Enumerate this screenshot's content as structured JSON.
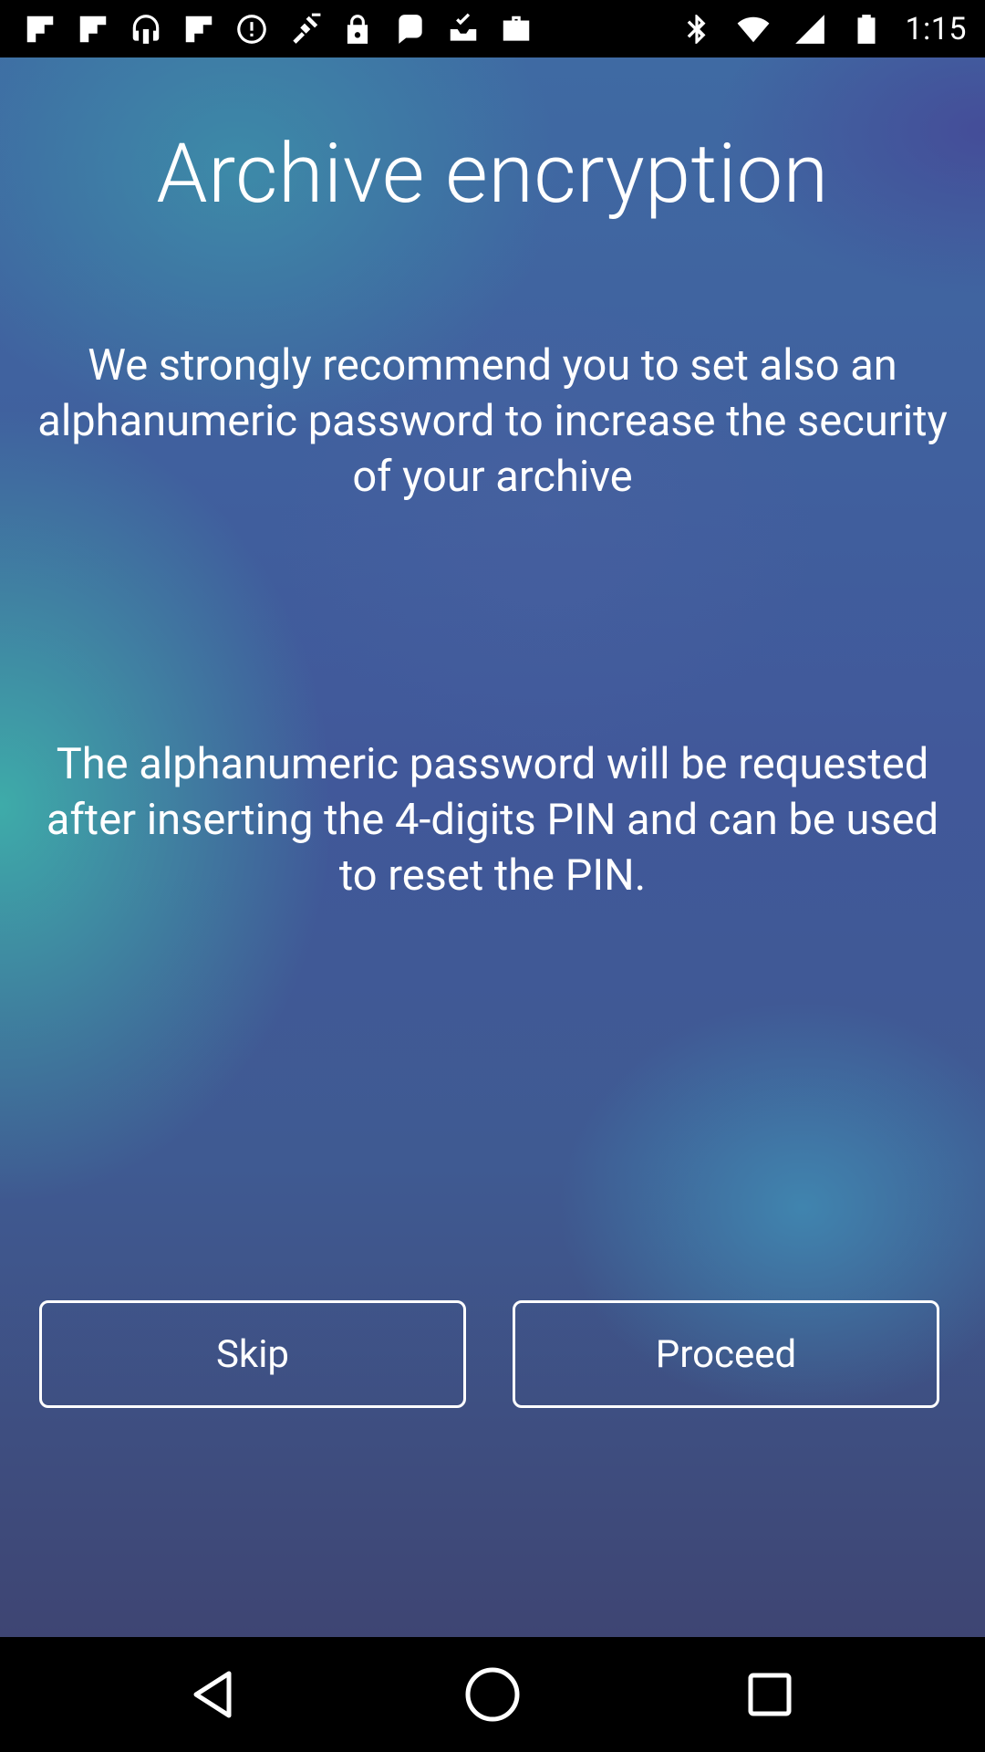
{
  "status_bar": {
    "time": "1:15",
    "left_icons": [
      "flipboard-icon",
      "flipboard-icon",
      "podcast-icon",
      "flipboard-icon",
      "data-saver-icon",
      "fake-gps-icon",
      "lock-icon",
      "message-icon",
      "inbox-check-icon",
      "briefcase-icon"
    ],
    "right_icons": [
      "bluetooth-icon",
      "wifi-icon",
      "signal-icon",
      "battery-icon"
    ]
  },
  "screen": {
    "title": "Archive encryption",
    "paragraph1": "We strongly recommend you to set also an alphanumeric password  to increase the security of your archive",
    "paragraph2": "The alphanumeric password will be requested after inserting the 4-digits PIN and can be used to reset the PIN."
  },
  "buttons": {
    "skip_label": "Skip",
    "proceed_label": "Proceed"
  },
  "nav_bar": {
    "icons": [
      "back-icon",
      "home-icon",
      "recent-apps-icon"
    ]
  }
}
